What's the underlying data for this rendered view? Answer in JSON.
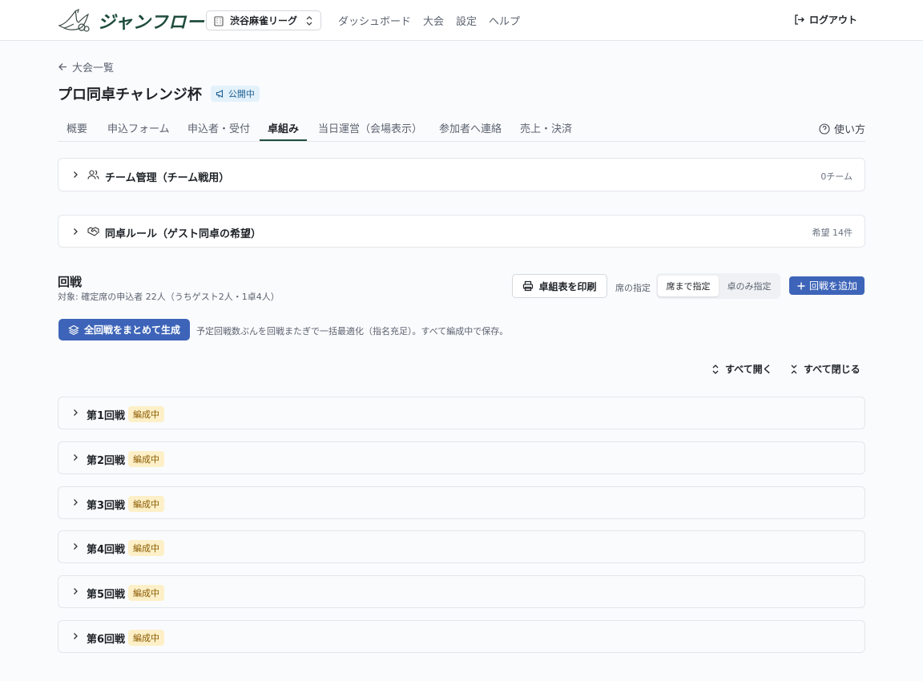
{
  "header": {
    "logo_text": "ジャンフロー",
    "org_name": "渋谷麻雀リーグ",
    "nav": [
      "ダッシュボード",
      "大会",
      "設定",
      "ヘルプ"
    ],
    "logout_label": "ログアウト"
  },
  "page": {
    "back_label": "大会一覧",
    "title": "プロ同卓チャレンジ杯",
    "status_badge": "公開中",
    "tabs": [
      "概要",
      "申込フォーム",
      "申込者・受付",
      "卓組み",
      "当日運営（会場表示）",
      "参加者へ連絡",
      "売上・決済"
    ],
    "active_tab": "卓組み",
    "help_label": "使い方"
  },
  "panels": {
    "team": {
      "title": "チーム管理（チーム戦用）",
      "meta": "0チーム"
    },
    "rule": {
      "title": "同卓ルール（ゲスト同卓の希望）",
      "meta": "希望 14件"
    }
  },
  "rounds_section": {
    "title": "回戦",
    "subtitle": "対象: 確定席の申込者 22人（うちゲスト2人・1卓4人）",
    "print_label": "卓組表を印刷",
    "seat_label": "席の指定",
    "seat_options": [
      "席まで指定",
      "卓のみ指定"
    ],
    "add_label": "回戦を追加",
    "generate_label": "全回戦をまとめて生成",
    "generate_note": "予定回戦数ぶんを回戦またぎで一括最適化（指名充足）。すべて編成中で保存。",
    "expand_all": "すべて開く",
    "collapse_all": "すべて閉じる",
    "rounds": [
      {
        "label": "第1回戦",
        "status": "編成中"
      },
      {
        "label": "第2回戦",
        "status": "編成中"
      },
      {
        "label": "第3回戦",
        "status": "編成中"
      },
      {
        "label": "第4回戦",
        "status": "編成中"
      },
      {
        "label": "第5回戦",
        "status": "編成中"
      },
      {
        "label": "第6回戦",
        "status": "編成中"
      }
    ]
  },
  "colors": {
    "brand": "#1f4d3d",
    "primary": "#3d64b8",
    "badge_bg": "#fdf0c8",
    "badge_fg": "#8a5a00",
    "public_bg": "#e3f1fb"
  }
}
